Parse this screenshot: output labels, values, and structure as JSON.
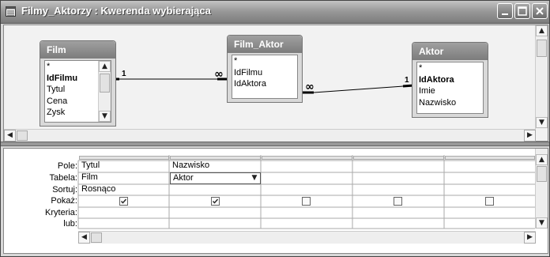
{
  "window": {
    "title": "Filmy_Aktorzy : Kwerenda wybierająca"
  },
  "tables": [
    {
      "name": "Film",
      "fields": [
        "*",
        "IdFilmu",
        "Tytul",
        "Cena",
        "Zysk"
      ],
      "bold": [
        1
      ]
    },
    {
      "name": "Film_Aktor",
      "fields": [
        "*",
        "IdFilmu",
        "IdAktora"
      ],
      "bold": []
    },
    {
      "name": "Aktor",
      "fields": [
        "*",
        "IdAktora",
        "Imie",
        "Nazwisko"
      ],
      "bold": [
        1
      ]
    }
  ],
  "relations": {
    "one_symbol": "1",
    "many_symbol": "∞"
  },
  "grid": {
    "row_labels": [
      "Pole:",
      "Tabela:",
      "Sortuj:",
      "Pokaż:",
      "Kryteria:",
      "lub:"
    ],
    "columns": [
      {
        "pole": "Tytul",
        "tabela": "Film",
        "sortuj": "Rosnąco",
        "pokaz": true
      },
      {
        "pole": "Nazwisko",
        "tabela": "Aktor",
        "sortuj": "",
        "pokaz": true
      },
      {
        "pole": "",
        "tabela": "",
        "sortuj": "",
        "pokaz": false
      },
      {
        "pole": "",
        "tabela": "",
        "sortuj": "",
        "pokaz": false
      },
      {
        "pole": "",
        "tabela": "",
        "sortuj": "",
        "pokaz": false
      }
    ]
  },
  "icons": {
    "title": "query-window-icon",
    "minimize": "minimize-icon",
    "maximize": "maximize-icon",
    "close": "close-icon"
  }
}
